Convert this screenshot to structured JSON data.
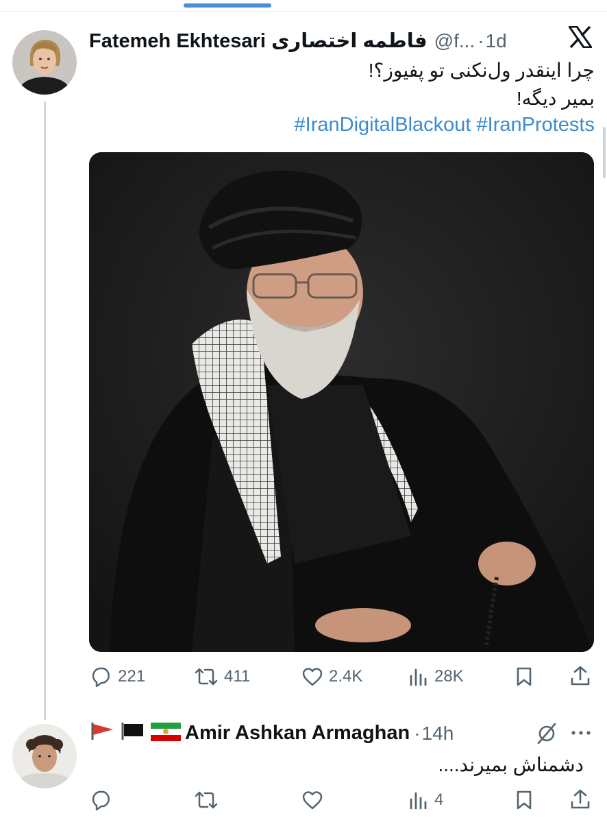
{
  "tweet": {
    "author_name": "Fatemeh Ekhtesari فاطمه اختصاری",
    "handle": "@f...",
    "separator": "·",
    "time": "1d",
    "text_line1": "چرا اینقدر ول‌نکنی تو پفیوز؟!",
    "text_line2": "بمیر دیگه!",
    "hashtags": "#IranDigitalBlackout #IranProtests",
    "stats": {
      "replies": "221",
      "reposts": "411",
      "likes": "2.4K",
      "views": "28K"
    }
  },
  "reply": {
    "author_name": "Amir Ashkan Armaghan",
    "separator": "·",
    "time": "14h",
    "text": "دشمناش بمیرند....",
    "stats": {
      "views": "4"
    }
  },
  "icons": {
    "platform": "x-logo-icon",
    "reply": "speech-bubble-icon",
    "repost": "repost-arrows-icon",
    "like": "heart-icon",
    "views": "bar-chart-icon",
    "bookmark": "bookmark-icon",
    "share": "share-upload-icon",
    "grok": "grok-slash-icon",
    "more": "more-dots-icon",
    "flags": [
      "red-flag-icon",
      "black-flag-icon",
      "iran-lion-sun-flag-icon"
    ]
  },
  "colors": {
    "hashtag": "#3b8bd0",
    "muted": "#536471",
    "thread_line": "#cfd9de"
  }
}
